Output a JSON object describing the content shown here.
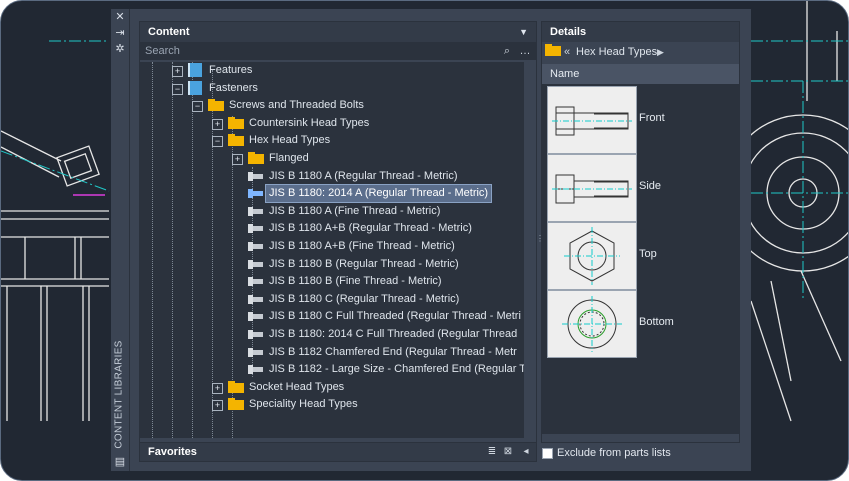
{
  "palette": {
    "side_title": "CONTENT LIBRARIES",
    "strip_icons": [
      "close-icon",
      "pin-icon",
      "gear-icon",
      "library-icon"
    ]
  },
  "content": {
    "title": "Content",
    "search_placeholder": "Search",
    "tree": [
      {
        "label": "Features",
        "kind": "book",
        "depth": 2,
        "toggle": "+"
      },
      {
        "label": "Fasteners",
        "kind": "book",
        "depth": 2,
        "toggle": "-"
      },
      {
        "label": "Screws and Threaded Bolts",
        "kind": "folder",
        "depth": 3,
        "toggle": "-"
      },
      {
        "label": "Countersink Head Types",
        "kind": "folder",
        "depth": 4,
        "toggle": "+"
      },
      {
        "label": "Hex Head Types",
        "kind": "folder",
        "depth": 4,
        "toggle": "-"
      },
      {
        "label": "Flanged",
        "kind": "folder",
        "depth": 5,
        "toggle": "+"
      },
      {
        "label": "JIS B 1180  A  (Regular Thread - Metric)",
        "kind": "part",
        "depth": 5
      },
      {
        "label": "JIS B 1180: 2014  A  (Regular Thread - Metric)",
        "kind": "part",
        "depth": 5,
        "selected": true
      },
      {
        "label": "JIS B 1180  A  (Fine Thread - Metric)",
        "kind": "part",
        "depth": 5
      },
      {
        "label": "JIS B 1180  A+B  (Regular Thread - Metric)",
        "kind": "part",
        "depth": 5
      },
      {
        "label": "JIS B 1180  A+B  (Fine Thread - Metric)",
        "kind": "part",
        "depth": 5
      },
      {
        "label": "JIS B 1180  B  (Regular Thread - Metric)",
        "kind": "part",
        "depth": 5
      },
      {
        "label": "JIS B 1180  B  (Fine Thread - Metric)",
        "kind": "part",
        "depth": 5
      },
      {
        "label": "JIS B 1180  C  (Regular Thread - Metric)",
        "kind": "part",
        "depth": 5
      },
      {
        "label": "JIS B 1180  C  Full Threaded  (Regular Thread - Metri",
        "kind": "part",
        "depth": 5
      },
      {
        "label": "JIS B 1180: 2014  C  Full Threaded  (Regular Thread",
        "kind": "part",
        "depth": 5
      },
      {
        "label": "JIS B 1182  Chamfered End  (Regular Thread - Metr",
        "kind": "part",
        "depth": 5
      },
      {
        "label": "JIS B 1182 - Large Size - Chamfered End  (Regular T",
        "kind": "part",
        "depth": 5
      },
      {
        "label": "Socket Head Types",
        "kind": "folder",
        "depth": 4,
        "toggle": "+"
      },
      {
        "label": "Speciality Head Types",
        "kind": "folder",
        "depth": 4,
        "toggle": "+"
      }
    ]
  },
  "favorites": {
    "title": "Favorites"
  },
  "details": {
    "title": "Details",
    "breadcrumb": "Hex Head Types",
    "column": "Name",
    "views": [
      {
        "label": "Front",
        "icon": "bolt-front-view-icon"
      },
      {
        "label": "Side",
        "icon": "bolt-side-view-icon"
      },
      {
        "label": "Top",
        "icon": "bolt-top-view-icon"
      },
      {
        "label": "Bottom",
        "icon": "bolt-bottom-view-icon"
      }
    ],
    "exclude_label": "Exclude from parts lists",
    "exclude_checked": false
  },
  "colors": {
    "accent_folder": "#f4b400",
    "selection": "#5b6e8c",
    "book": "#4aa3df"
  }
}
